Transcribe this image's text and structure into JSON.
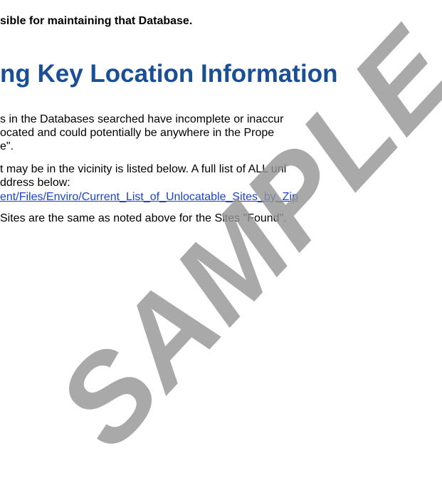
{
  "top_text": "sible for maintaining that Database.",
  "section": {
    "heading": "ng Key Location Information",
    "para1": [
      "s in the Databases searched have incomplete or inaccur",
      "ocated and could potentially be anywhere in the Prope",
      "e\"."
    ],
    "para2": [
      "t may be in the vicinity is listed below. A full list of ALL unl",
      "ddress below:"
    ],
    "link_text": "ent/Files/Enviro/Current_List_of_Unlocatable_Sites_by_Zip",
    "para3": "Sites are the same as noted above for the Sites \"Found\"."
  },
  "watermark": "SAMPLE"
}
